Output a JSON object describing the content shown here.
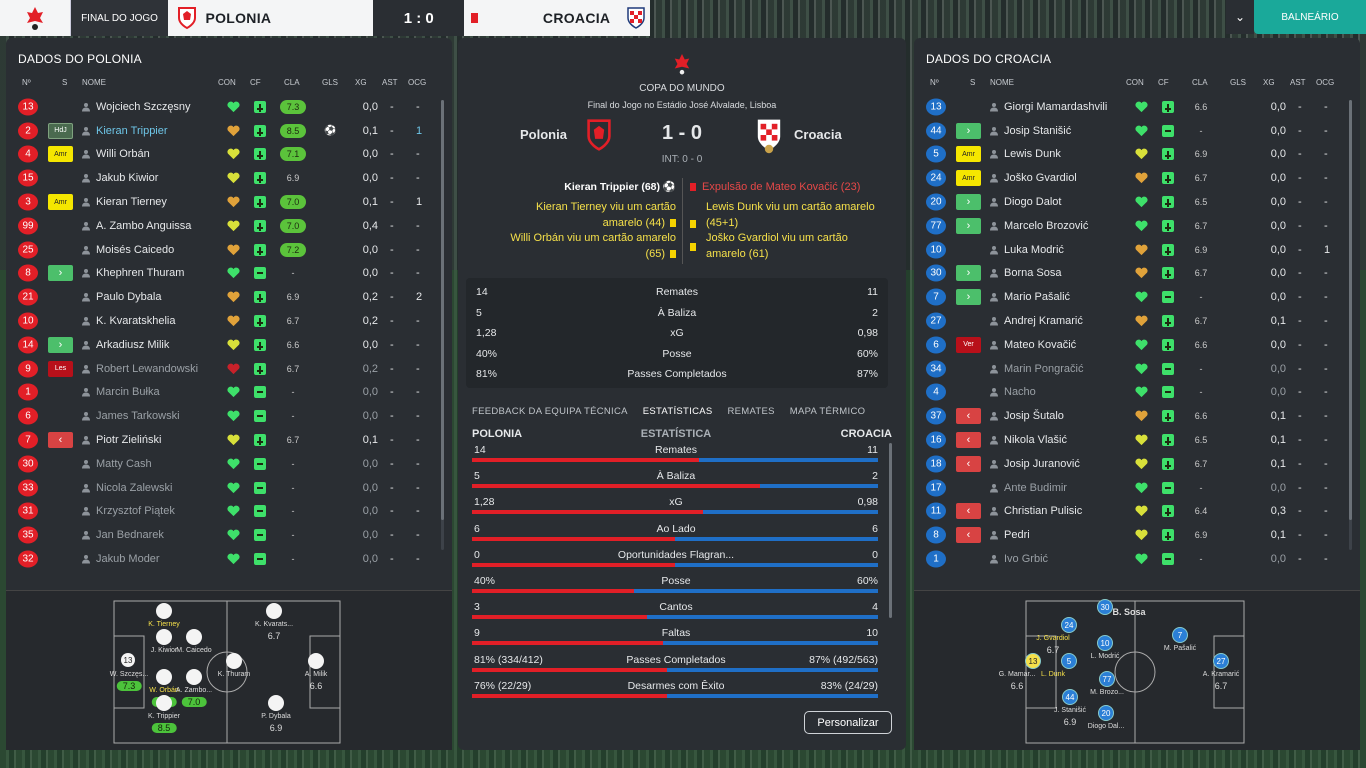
{
  "topbar": {
    "left_label": "FINAL DO JOGO",
    "home": "POLONIA",
    "score": "1 : 0",
    "away": "CROACIA",
    "right_button": "BALNEÁRIO"
  },
  "left": {
    "title": "DADOS DO POLONIA",
    "columns": [
      "Nº",
      "S",
      "NOME",
      "CON",
      "CF",
      "CLA",
      "GLS",
      "XG",
      "AST",
      "OCG"
    ],
    "players": [
      {
        "num": "13",
        "s": "",
        "sclass": "",
        "name": "Wojciech Szczęsny",
        "con": "g",
        "cla": "7.3",
        "clac": "g",
        "gls": "",
        "xg": "0,0",
        "ast": "-",
        "ocg": "-"
      },
      {
        "num": "2",
        "s": "HdJ",
        "sclass": "hdj",
        "name": "Kieran Trippier",
        "con": "o",
        "cla": "8.5",
        "clac": "g",
        "gls": "⚽",
        "xg": "0,1",
        "ast": "-",
        "ocg": "1",
        "hl": true
      },
      {
        "num": "4",
        "s": "Amr",
        "sclass": "amr",
        "name": "Willi Orbán",
        "con": "y",
        "cla": "7.1",
        "clac": "g",
        "gls": "",
        "xg": "0,0",
        "ast": "-",
        "ocg": "-"
      },
      {
        "num": "15",
        "s": "",
        "sclass": "",
        "name": "Jakub Kiwior",
        "con": "y",
        "cla": "6.9",
        "clac": "",
        "gls": "",
        "xg": "0,0",
        "ast": "-",
        "ocg": "-"
      },
      {
        "num": "3",
        "s": "Amr",
        "sclass": "amr",
        "name": "Kieran Tierney",
        "con": "o",
        "cla": "7.0",
        "clac": "g",
        "gls": "",
        "xg": "0,1",
        "ast": "-",
        "ocg": "1"
      },
      {
        "num": "99",
        "s": "",
        "sclass": "",
        "name": "A. Zambo Anguissa",
        "con": "y",
        "cla": "7.0",
        "clac": "g",
        "gls": "",
        "xg": "0,4",
        "ast": "-",
        "ocg": "-"
      },
      {
        "num": "25",
        "s": "",
        "sclass": "",
        "name": "Moisés Caicedo",
        "con": "o",
        "cla": "7.2",
        "clac": "g",
        "gls": "",
        "xg": "0,0",
        "ast": "-",
        "ocg": "-"
      },
      {
        "num": "8",
        "s": "›",
        "sclass": "in",
        "name": "Khephren Thuram",
        "con": "g",
        "cla": "-",
        "clac": "",
        "gls": "",
        "xg": "0,0",
        "ast": "-",
        "ocg": "-"
      },
      {
        "num": "21",
        "s": "",
        "sclass": "",
        "name": "Paulo Dybala",
        "con": "o",
        "cla": "6.9",
        "clac": "",
        "gls": "",
        "xg": "0,2",
        "ast": "-",
        "ocg": "2"
      },
      {
        "num": "10",
        "s": "",
        "sclass": "",
        "name": "K. Kvaratskhelia",
        "con": "o",
        "cla": "6.7",
        "clac": "",
        "gls": "",
        "xg": "0,2",
        "ast": "-",
        "ocg": "-"
      },
      {
        "num": "14",
        "s": "›",
        "sclass": "in",
        "name": "Arkadiusz Milik",
        "con": "y",
        "cla": "6.6",
        "clac": "",
        "gls": "",
        "xg": "0,0",
        "ast": "-",
        "ocg": "-"
      },
      {
        "num": "9",
        "s": "Les",
        "sclass": "les",
        "name": "Robert Lewandowski",
        "con": "r",
        "cla": "6.7",
        "clac": "",
        "gls": "",
        "xg": "0,2",
        "ast": "-",
        "ocg": "-",
        "dim": true
      },
      {
        "num": "1",
        "s": "",
        "sclass": "",
        "name": "Marcin Bułka",
        "con": "g",
        "cla": "-",
        "clac": "",
        "gls": "",
        "xg": "0,0",
        "ast": "-",
        "ocg": "-",
        "dim": true
      },
      {
        "num": "6",
        "s": "",
        "sclass": "",
        "name": "James Tarkowski",
        "con": "g",
        "cla": "-",
        "clac": "",
        "gls": "",
        "xg": "0,0",
        "ast": "-",
        "ocg": "-",
        "dim": true
      },
      {
        "num": "7",
        "s": "‹",
        "sclass": "out",
        "name": "Piotr Zieliński",
        "con": "y",
        "cla": "6.7",
        "clac": "",
        "gls": "",
        "xg": "0,1",
        "ast": "-",
        "ocg": "-"
      },
      {
        "num": "30",
        "s": "",
        "sclass": "",
        "name": "Matty Cash",
        "con": "g",
        "cla": "-",
        "clac": "",
        "gls": "",
        "xg": "0,0",
        "ast": "-",
        "ocg": "-",
        "dim": true
      },
      {
        "num": "33",
        "s": "",
        "sclass": "",
        "name": "Nicola Zalewski",
        "con": "g",
        "cla": "-",
        "clac": "",
        "gls": "",
        "xg": "0,0",
        "ast": "-",
        "ocg": "-",
        "dim": true
      },
      {
        "num": "31",
        "s": "",
        "sclass": "",
        "name": "Krzysztof Piątek",
        "con": "g",
        "cla": "-",
        "clac": "",
        "gls": "",
        "xg": "0,0",
        "ast": "-",
        "ocg": "-",
        "dim": true
      },
      {
        "num": "35",
        "s": "",
        "sclass": "",
        "name": "Jan Bednarek",
        "con": "g",
        "cla": "-",
        "clac": "",
        "gls": "",
        "xg": "0,0",
        "ast": "-",
        "ocg": "-",
        "dim": true
      },
      {
        "num": "32",
        "s": "",
        "sclass": "",
        "name": "Jakub Moder",
        "con": "g",
        "cla": "-",
        "clac": "",
        "gls": "",
        "xg": "0,0",
        "ast": "-",
        "ocg": "-",
        "dim": true
      }
    ]
  },
  "right": {
    "title": "DADOS DO CROACIA",
    "columns": [
      "Nº",
      "S",
      "NOME",
      "CON",
      "CF",
      "CLA",
      "GLS",
      "XG",
      "AST",
      "OCG"
    ],
    "players": [
      {
        "num": "13",
        "s": "",
        "sclass": "",
        "name": "Giorgi Mamardashvili",
        "con": "g",
        "cla": "6.6",
        "xg": "0,0",
        "ast": "-",
        "ocg": "-"
      },
      {
        "num": "44",
        "s": "›",
        "sclass": "in",
        "name": "Josip Stanišić",
        "con": "g",
        "cla": "-",
        "xg": "0,0",
        "ast": "-",
        "ocg": "-"
      },
      {
        "num": "5",
        "s": "Amr",
        "sclass": "amr",
        "name": "Lewis Dunk",
        "con": "y",
        "cla": "6.9",
        "xg": "0,0",
        "ast": "-",
        "ocg": "-"
      },
      {
        "num": "24",
        "s": "Amr",
        "sclass": "amr",
        "name": "Joško Gvardiol",
        "con": "o",
        "cla": "6.7",
        "xg": "0,0",
        "ast": "-",
        "ocg": "-"
      },
      {
        "num": "20",
        "s": "›",
        "sclass": "in",
        "name": "Diogo Dalot",
        "con": "g",
        "cla": "6.5",
        "xg": "0,0",
        "ast": "-",
        "ocg": "-"
      },
      {
        "num": "77",
        "s": "›",
        "sclass": "in",
        "name": "Marcelo Brozović",
        "con": "g",
        "cla": "6.7",
        "xg": "0,0",
        "ast": "-",
        "ocg": "-"
      },
      {
        "num": "10",
        "s": "",
        "sclass": "",
        "name": "Luka Modrić",
        "con": "o",
        "cla": "6.9",
        "xg": "0,0",
        "ast": "-",
        "ocg": "1"
      },
      {
        "num": "30",
        "s": "›",
        "sclass": "in",
        "name": "Borna Sosa",
        "con": "o",
        "cla": "6.7",
        "xg": "0,0",
        "ast": "-",
        "ocg": "-"
      },
      {
        "num": "7",
        "s": "›",
        "sclass": "in",
        "name": "Mario Pašalić",
        "con": "g",
        "cla": "-",
        "xg": "0,0",
        "ast": "-",
        "ocg": "-"
      },
      {
        "num": "27",
        "s": "",
        "sclass": "",
        "name": "Andrej Kramarić",
        "con": "o",
        "cla": "6.7",
        "xg": "0,1",
        "ast": "-",
        "ocg": "-"
      },
      {
        "num": "6",
        "s": "Ver",
        "sclass": "ver",
        "name": "Mateo Kovačić",
        "con": "g",
        "cla": "6.6",
        "xg": "0,0",
        "ast": "-",
        "ocg": "-"
      },
      {
        "num": "34",
        "s": "",
        "sclass": "",
        "name": "Marin Pongračić",
        "con": "g",
        "cla": "-",
        "xg": "0,0",
        "ast": "-",
        "ocg": "-",
        "dim": true
      },
      {
        "num": "4",
        "s": "",
        "sclass": "",
        "name": "Nacho",
        "con": "g",
        "cla": "-",
        "xg": "0,0",
        "ast": "-",
        "ocg": "-",
        "dim": true
      },
      {
        "num": "37",
        "s": "‹",
        "sclass": "out",
        "name": "Josip Šutalo",
        "con": "o",
        "cla": "6.6",
        "xg": "0,1",
        "ast": "-",
        "ocg": "-"
      },
      {
        "num": "16",
        "s": "‹",
        "sclass": "out",
        "name": "Nikola Vlašić",
        "con": "y",
        "cla": "6.5",
        "xg": "0,1",
        "ast": "-",
        "ocg": "-"
      },
      {
        "num": "18",
        "s": "‹",
        "sclass": "out",
        "name": "Josip Juranović",
        "con": "y",
        "cla": "6.7",
        "xg": "0,1",
        "ast": "-",
        "ocg": "-"
      },
      {
        "num": "17",
        "s": "",
        "sclass": "",
        "name": "Ante Budimir",
        "con": "g",
        "cla": "-",
        "xg": "0,0",
        "ast": "-",
        "ocg": "-",
        "dim": true
      },
      {
        "num": "11",
        "s": "‹",
        "sclass": "out",
        "name": "Christian Pulisic",
        "con": "y",
        "cla": "6.4",
        "xg": "0,3",
        "ast": "-",
        "ocg": "-"
      },
      {
        "num": "8",
        "s": "‹",
        "sclass": "out",
        "name": "Pedri",
        "con": "y",
        "cla": "6.9",
        "xg": "0,1",
        "ast": "-",
        "ocg": "-"
      },
      {
        "num": "1",
        "s": "",
        "sclass": "",
        "name": "Ivo Grbić",
        "con": "g",
        "cla": "-",
        "xg": "0,0",
        "ast": "-",
        "ocg": "-",
        "dim": true
      }
    ]
  },
  "center": {
    "competition": "COPA DO MUNDO",
    "venue": "Final do Jogo no Estádio José Alvalade, Lisboa",
    "home": "Polonia",
    "away": "Croacia",
    "score": "1 - 0",
    "ht": "INT: 0 - 0",
    "home_events": [
      "Kieran Trippier (68)",
      "Kieran Tierney viu um cartão amarelo (44)",
      "Willi Orbán viu um cartão amarelo (65)"
    ],
    "away_events": [
      "Expulsão de Mateo Kovačić (23)",
      "Lewis Dunk viu um cartão amarelo (45+1)",
      "Joško Gvardiol viu um cartão amarelo (61)"
    ],
    "summary": [
      {
        "l": "14",
        "c": "Remates",
        "r": "11"
      },
      {
        "l": "5",
        "c": "À Baliza",
        "r": "2"
      },
      {
        "l": "1,28",
        "c": "xG",
        "r": "0,98"
      },
      {
        "l": "40%",
        "c": "Posse",
        "r": "60%"
      },
      {
        "l": "81%",
        "c": "Passes Completados",
        "r": "87%"
      }
    ],
    "tabs": [
      "FEEDBACK DA EQUIPA TÉCNICA",
      "ESTATÍSTICAS",
      "REMATES",
      "MAPA TÉRMICO"
    ],
    "stats_header": {
      "l": "POLONIA",
      "c": "ESTATÍSTICA",
      "r": "CROACIA"
    },
    "stats": [
      {
        "l": "14",
        "c": "Remates",
        "r": "11",
        "share": 0.56
      },
      {
        "l": "5",
        "c": "À Baliza",
        "r": "2",
        "share": 0.71
      },
      {
        "l": "1,28",
        "c": "xG",
        "r": "0,98",
        "share": 0.57
      },
      {
        "l": "6",
        "c": "Ao Lado",
        "r": "6",
        "share": 0.5
      },
      {
        "l": "0",
        "c": "Oportunidades Flagran...",
        "r": "0",
        "share": 0.5
      },
      {
        "l": "40%",
        "c": "Posse",
        "r": "60%",
        "share": 0.4
      },
      {
        "l": "3",
        "c": "Cantos",
        "r": "4",
        "share": 0.43
      },
      {
        "l": "9",
        "c": "Faltas",
        "r": "10",
        "share": 0.47
      },
      {
        "l": "81% (334/412)",
        "c": "Passes Completados",
        "r": "87% (492/563)",
        "share": 0.48
      },
      {
        "l": "76% (22/29)",
        "c": "Desarmes com Êxito",
        "r": "83% (24/29)",
        "share": 0.48
      }
    ],
    "custom_button": "Personalizar"
  },
  "pitch_left": [
    {
      "lbl": "K. Tierney",
      "yl": true
    },
    {
      "lbl": "K. Kvarats...",
      "rat": "6.7"
    },
    {
      "lbl": "J. Kiwior",
      "rat": ""
    },
    {
      "lbl": "M. Caicedo",
      "rat": ""
    },
    {
      "lbl": "W. Szczęs...",
      "rat": "7.3",
      "num": "13"
    },
    {
      "lbl": "K. Thuram"
    },
    {
      "lbl": "A. Milik",
      "rat": "6.6"
    },
    {
      "lbl": "W. Orbán",
      "yl": true,
      "rat": "7.1"
    },
    {
      "lbl": "A. Zambo...",
      "rat": "7.0"
    },
    {
      "lbl": "K. Trippier",
      "rat": "8.5"
    },
    {
      "lbl": "P. Dybala",
      "rat": "6.9"
    }
  ],
  "pitch_right": [
    {
      "num": "30",
      "lbl": "B. Sosa"
    },
    {
      "num": "24",
      "lbl": "J. Gvardiol",
      "yl": true,
      "rat": "6.7"
    },
    {
      "num": "10",
      "lbl": "L. Modrić"
    },
    {
      "num": "7",
      "lbl": "M. Pašalić"
    },
    {
      "num": "13",
      "lbl": "G. Mamar...",
      "rat": "6.6"
    },
    {
      "num": "5",
      "lbl": "L. Dunk",
      "yl": true
    },
    {
      "num": "27",
      "lbl": "A. Kramarić",
      "rat": "6.7"
    },
    {
      "num": "77",
      "lbl": "M. Brozo..."
    },
    {
      "num": "44",
      "lbl": "J. Stanišić",
      "rat": "6.9"
    },
    {
      "num": "20",
      "lbl": "Diogo Dal..."
    }
  ],
  "colors": {
    "home": "#e21f27",
    "away": "#1f6fc7",
    "accent": "#1aa99a"
  }
}
